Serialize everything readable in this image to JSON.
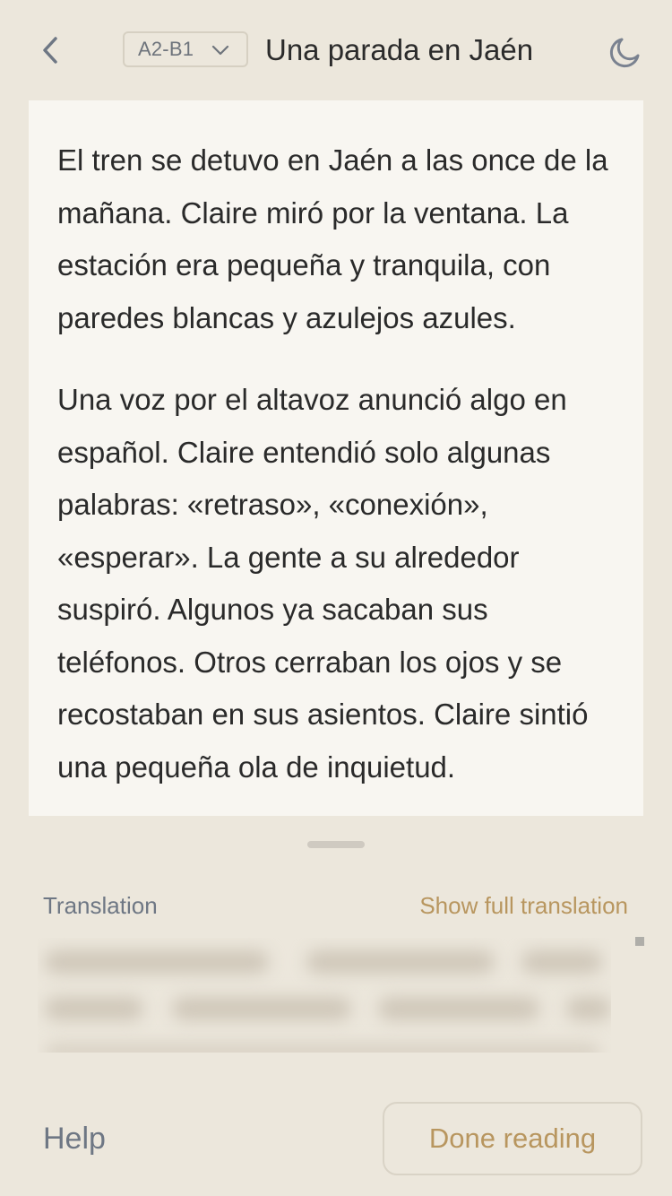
{
  "header": {
    "back_icon": "chevron-left-icon",
    "level": {
      "selected": "A2-B1",
      "icon": "chevron-down-icon"
    },
    "title": "Una parada en Jaén",
    "theme_icon": "moon-icon"
  },
  "reading": {
    "paragraphs": [
      "El tren se detuvo en Jaén a las once de la mañana. Claire miró por la ventana. La estación era pequeña y tranquila, con paredes blancas y azulejos azules.",
      "Una voz por el altavoz anunció algo en español. Claire entendió solo algunas palabras: «retraso», «conexión», «esperar». La gente a su alrededor suspiró. Algunos ya sacaban sus teléfonos. Otros cerraban los ojos y se recostaban en sus asientos. Claire sintió una pequeña ola de inquietud."
    ]
  },
  "translation": {
    "label": "Translation",
    "show_full": "Show full translation"
  },
  "footer": {
    "help": "Help",
    "done": "Done reading"
  },
  "colors": {
    "background": "#ECE7DC",
    "card": "#F8F6F1",
    "accent": "#B8965F",
    "muted": "#6E7784"
  }
}
